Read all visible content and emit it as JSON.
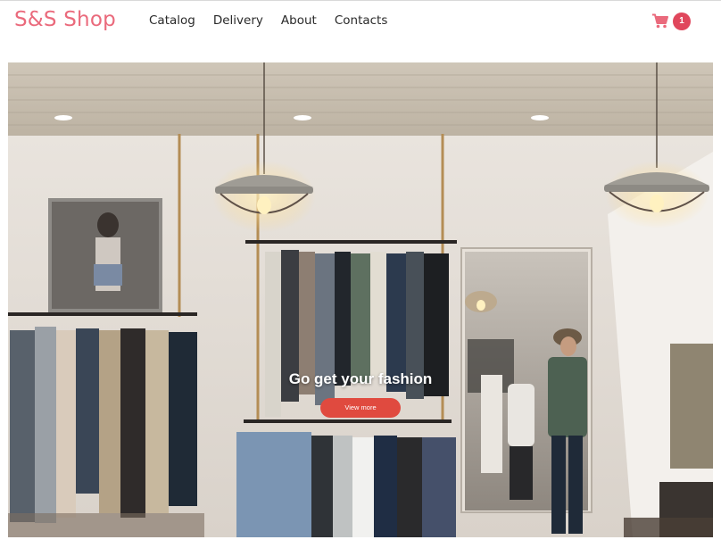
{
  "header": {
    "logo": "S&S Shop",
    "nav": [
      "Catalog",
      "Delivery",
      "About",
      "Contacts"
    ],
    "cart_count": "1"
  },
  "hero": {
    "title": "Go get your fashion",
    "button_label": "View more"
  },
  "colors": {
    "brand": "#ea6a7c",
    "badge": "#e0475c",
    "button": "#e04a3f"
  },
  "icons": [
    "shopping-cart-icon"
  ]
}
